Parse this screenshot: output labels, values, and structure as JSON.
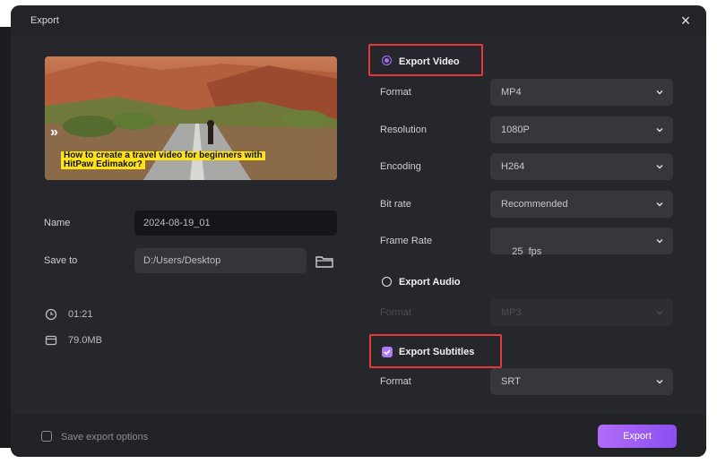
{
  "dialog": {
    "title": "Export",
    "close_icon": "×"
  },
  "preview": {
    "caption_line1": "How to create a travel video for beginners with",
    "caption_line2": "HitPaw Edimakor?",
    "arrows": "»"
  },
  "left": {
    "name_label": "Name",
    "name_value": "2024-08-19_01",
    "save_to_label": "Save to",
    "save_to_value": "D:/Users/Desktop",
    "duration": "01:21",
    "size": "79.0MB"
  },
  "video": {
    "heading": "Export Video",
    "fields": [
      {
        "label": "Format",
        "value": "MP4"
      },
      {
        "label": "Resolution",
        "value": "1080P"
      },
      {
        "label": "Encoding",
        "value": "H264"
      },
      {
        "label": "Bit rate",
        "value": "Recommended"
      },
      {
        "label": "Frame Rate",
        "value": "25  fps"
      }
    ]
  },
  "audio": {
    "heading": "Export Audio",
    "format_label": "Format",
    "format_value": "MP3"
  },
  "subtitles": {
    "heading": "Export Subtitles",
    "format_label": "Format",
    "format_value": "SRT"
  },
  "footer": {
    "save_options_label": "Save export options",
    "export_label": "Export"
  },
  "colors": {
    "accent": "#a46cf5",
    "highlight_box": "#e53935",
    "dialog_bg": "#26272c"
  }
}
